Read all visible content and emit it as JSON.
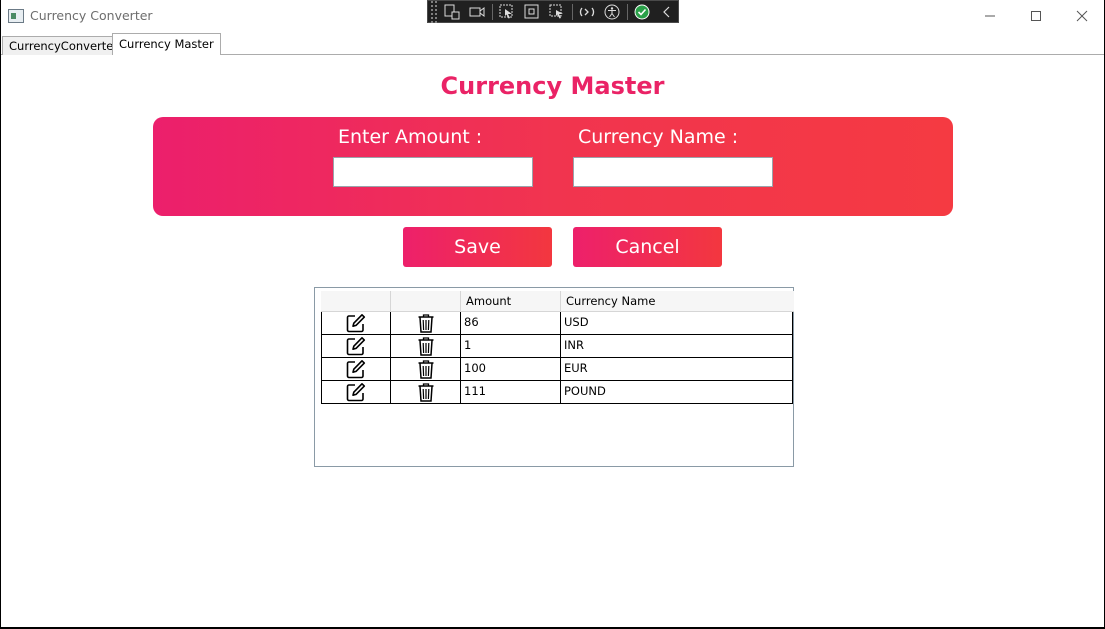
{
  "window": {
    "title": "Currency Converter"
  },
  "tabs": [
    {
      "label": "CurrencyConverter",
      "active": false
    },
    {
      "label": "Currency Master",
      "active": true
    }
  ],
  "page": {
    "title": "Currency Master",
    "amount_label": "Enter Amount :",
    "amount_value": "",
    "currency_label": "Currency Name :",
    "currency_value": "",
    "save_label": "Save",
    "cancel_label": "Cancel"
  },
  "grid": {
    "columns": [
      "",
      "",
      "Amount",
      "Currency Name"
    ],
    "rows": [
      {
        "amount": "86",
        "currency": "USD"
      },
      {
        "amount": "1",
        "currency": "INR"
      },
      {
        "amount": "100",
        "currency": "EUR"
      },
      {
        "amount": "111",
        "currency": "POUND"
      }
    ]
  },
  "colors": {
    "accent": "#ea2366",
    "gradient_start": "#ec1f6c",
    "gradient_end": "#f53a42"
  },
  "icons": {
    "edit": "edit-icon",
    "delete": "trash-icon"
  }
}
